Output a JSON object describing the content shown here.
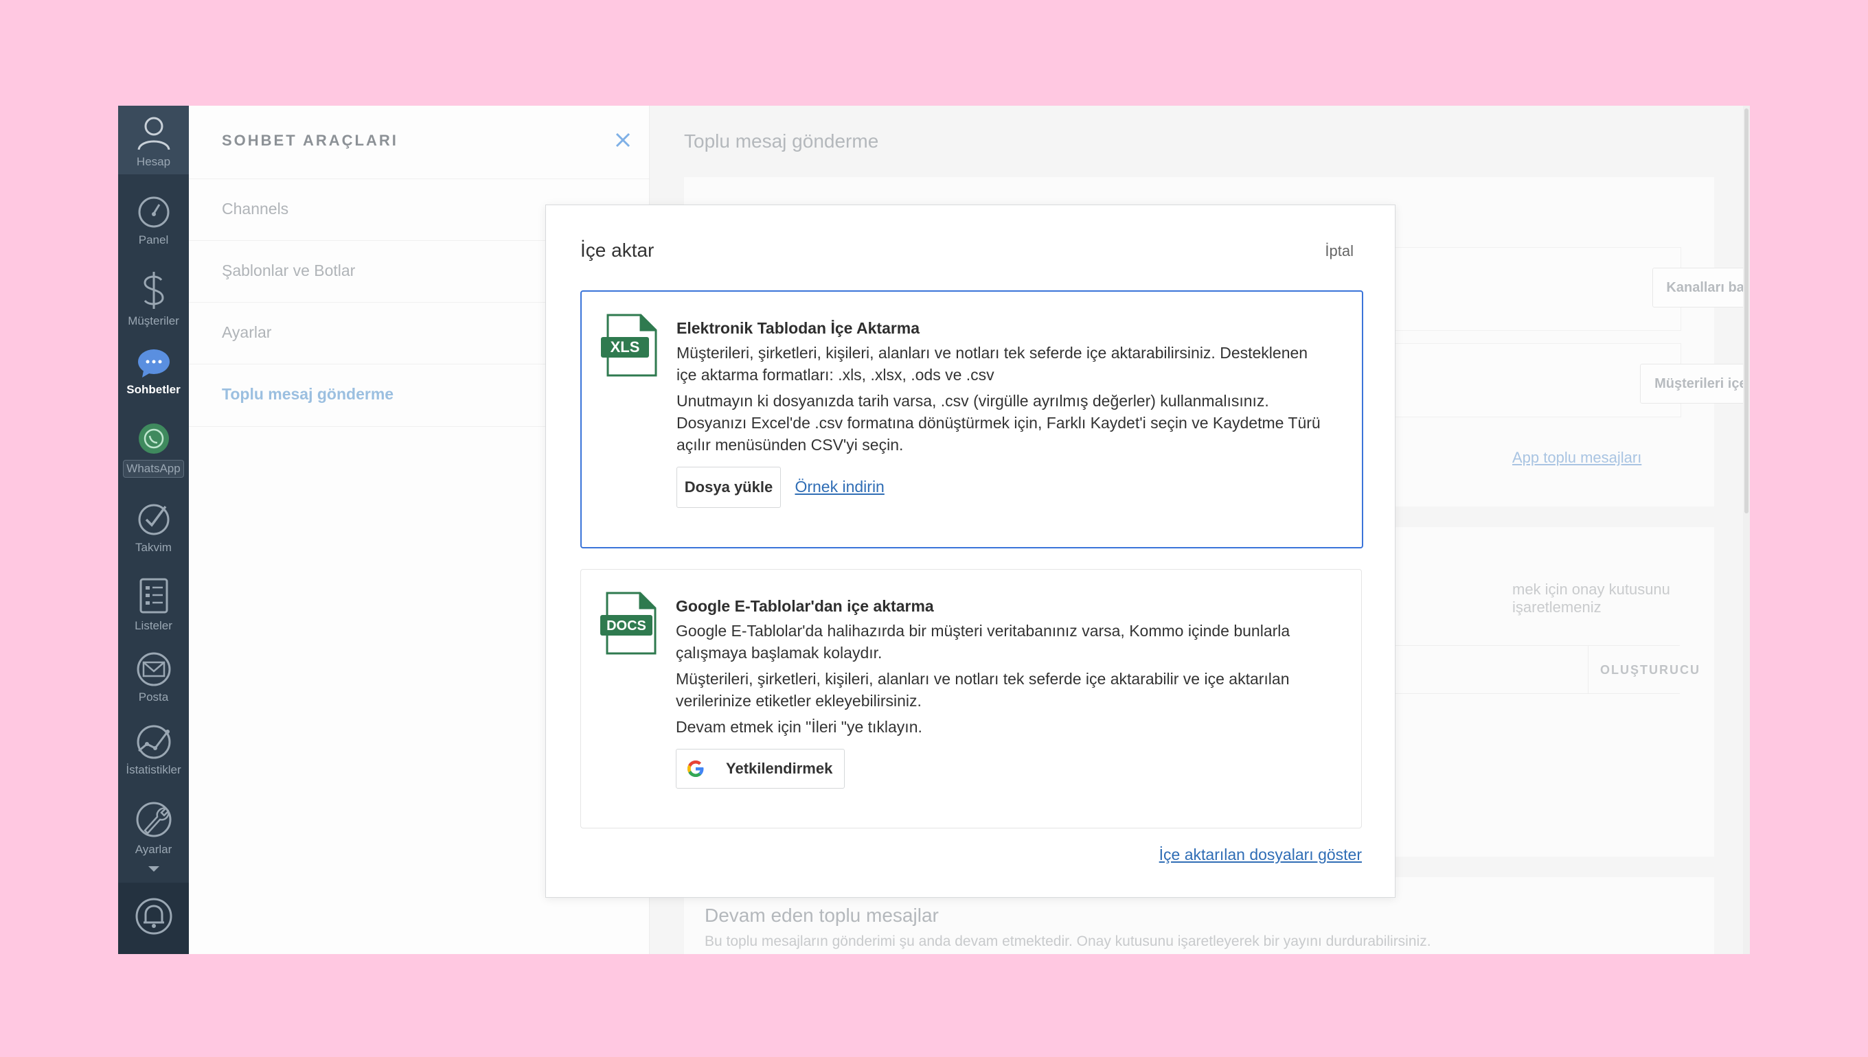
{
  "nav": {
    "items": [
      {
        "label": "Hesap",
        "icon": "user-icon"
      },
      {
        "label": "Panel",
        "icon": "speedometer-icon"
      },
      {
        "label": "Müşteriler",
        "icon": "dollar-icon"
      },
      {
        "label": "Sohbetler",
        "icon": "chat-bubble-icon",
        "active": true
      },
      {
        "label": "WhatsApp",
        "icon": "whatsapp-icon"
      },
      {
        "label": "Takvim",
        "icon": "checkmark-icon"
      },
      {
        "label": "Listeler",
        "icon": "list-icon"
      },
      {
        "label": "Posta",
        "icon": "mail-icon"
      },
      {
        "label": "İstatistikler",
        "icon": "chart-icon"
      },
      {
        "label": "Ayarlar",
        "icon": "wrench-icon"
      }
    ]
  },
  "panel": {
    "title": "SOHBET ARAÇLARI",
    "items": [
      {
        "label": "Channels"
      },
      {
        "label": "Şablonlar ve Botlar"
      },
      {
        "label": "Ayarlar"
      },
      {
        "label": "Toplu mesaj gönderme",
        "active": true
      }
    ]
  },
  "main": {
    "title": "Toplu mesaj gönderme",
    "connect_channels_button": "Kanalları bağlayın",
    "import_customers_button": "Müşterileri içe aktar",
    "whatsapp_link": "App toplu mesajları",
    "checkbox_hint": "mek için onay kutusunu işaretlemeniz",
    "col_creator": "OLUŞTURUCU",
    "ongoing_title": "Devam eden toplu mesajlar",
    "ongoing_desc": "Bu toplu mesajların gönderimi şu anda devam etmektedir. Onay kutusunu işaretleyerek bir yayını durdurabilirsiniz."
  },
  "modal": {
    "title": "İçe aktar",
    "cancel": "İptal",
    "xls": {
      "badge": "XLS",
      "heading": "Elektronik Tablodan İçe Aktarma",
      "p1": "Müşterileri, şirketleri, kişileri, alanları ve notları tek seferde içe aktarabilirsiniz. Desteklenen içe aktarma formatları: .xls, .xlsx, .ods ve .csv",
      "p2": "Unutmayın ki dosyanızda tarih varsa, .csv (virgülle ayrılmış değerler) kullanmalısınız. Dosyanızı Excel'de .csv formatına dönüştürmek için, Farklı Kaydet'i seçin ve Kaydetme Türü açılır menüsünden CSV'yi seçin.",
      "upload_button": "Dosya yükle",
      "sample_link": "Örnek indirin"
    },
    "gs": {
      "badge": "DOCS",
      "heading": "Google E-Tablolar'dan içe aktarma",
      "p1": "Google E-Tablolar'da halihazırda bir müşteri veritabanınız varsa, Kommo içinde bunlarla çalışmaya başlamak kolaydır.",
      "p2": "Müşterileri, şirketleri, kişileri, alanları ve notları tek seferde içe aktarabilir ve içe aktarılan verilerinize etiketler ekleyebilirsiniz.",
      "p3": "Devam etmek için \"İleri \"ye tıklayın.",
      "authorize_button": "Yetkilendirmek"
    },
    "show_imported_link": "İçe aktarılan dosyaları göster"
  },
  "colors": {
    "nav_bg": "#2c3b4a",
    "accent_blue": "#3a74d9",
    "link_blue": "#2f6db5",
    "file_green": "#2f7a4f",
    "page_bg": "#ffc8e1"
  }
}
